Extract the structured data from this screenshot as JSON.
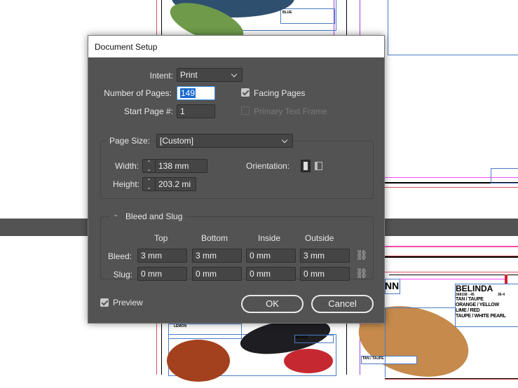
{
  "dialog": {
    "title": "Document Setup",
    "intent_label": "Intent:",
    "intent_value": "Print",
    "num_pages_label": "Number of Pages:",
    "num_pages_value": "149",
    "start_page_label": "Start Page #:",
    "start_page_value": "1",
    "facing_pages_label": "Facing Pages",
    "facing_pages_checked": true,
    "primary_text_frame_label": "Primary Text Frame",
    "primary_text_frame_checked": false,
    "page_size_label": "Page Size:",
    "page_size_value": "[Custom]",
    "width_label": "Width:",
    "width_value": "138 mm",
    "height_label": "Height:",
    "height_value": "203.2 mi",
    "orientation_label": "Orientation:",
    "orientation_selected": "portrait",
    "bleed_slug_title": "Bleed and Slug",
    "columns": [
      "Top",
      "Bottom",
      "Inside",
      "Outside"
    ],
    "bleed_label": "Bleed:",
    "bleed_values": [
      "3 mm",
      "3 mm",
      "0 mm",
      "3 mm"
    ],
    "slug_label": "Slug:",
    "slug_values": [
      "0 mm",
      "0 mm",
      "0 mm",
      "0 mm"
    ],
    "preview_label": "Preview",
    "preview_checked": true,
    "ok_label": "OK",
    "cancel_label": "Cancel"
  },
  "canvas": {
    "labels": [
      "BLUE",
      "LEMON",
      "BLACK",
      "TAN / TAUPE",
      "NN"
    ],
    "product": {
      "name": "BELINDA",
      "code": "368158 - 45",
      "sizes": "36-4",
      "colors": [
        "TAN / TAUPE",
        "ORANGE / YELLOW",
        "LIME / RED",
        "TAUPE / WHITE PEARL"
      ]
    }
  },
  "colors": {
    "panel": "#535353",
    "accent": "#1a6bd1",
    "guide_magenta": "#ff44ff",
    "frame_blue": "#4a7cc4"
  }
}
